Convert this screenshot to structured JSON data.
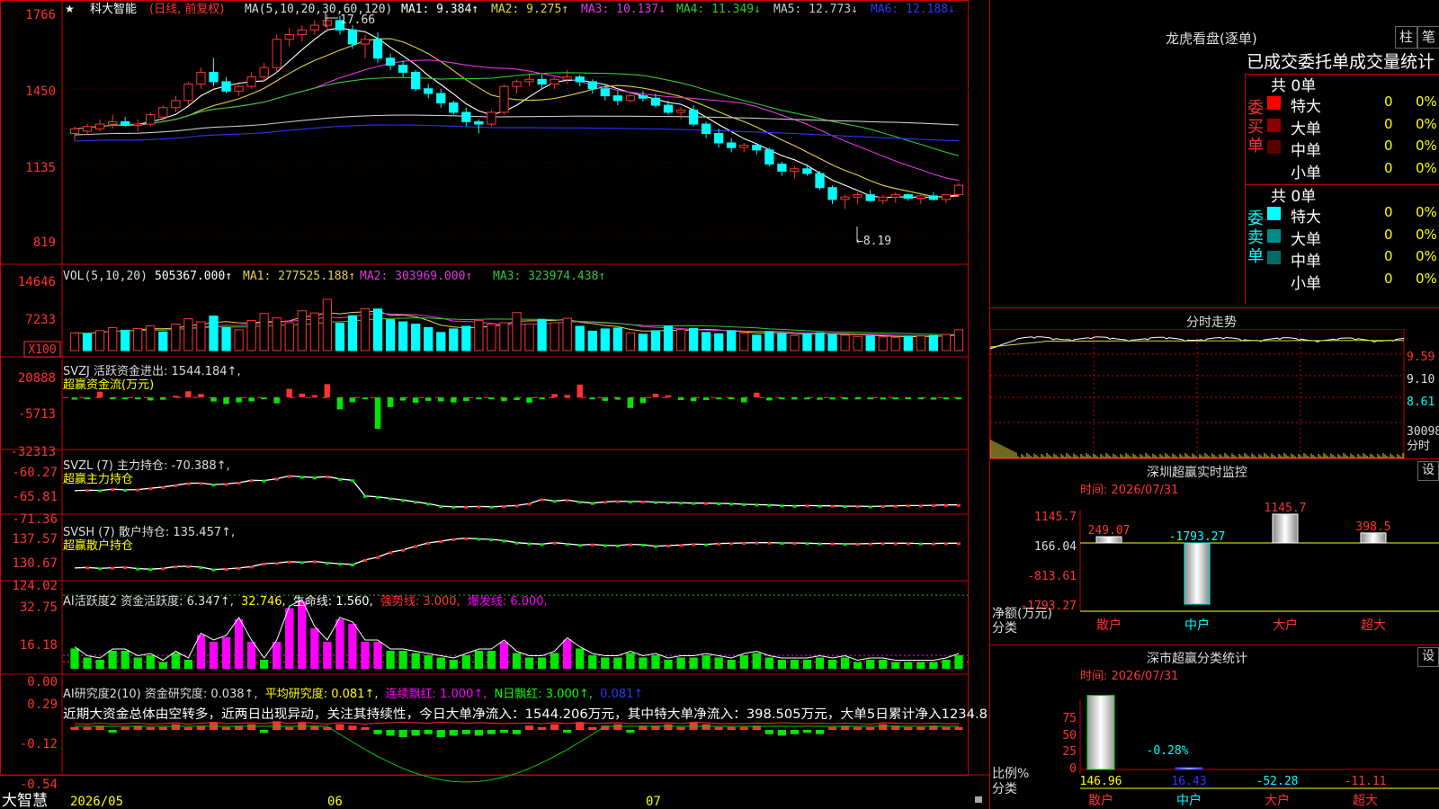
{
  "app": {
    "brand": "大智慧",
    "dates": [
      "2026/05",
      "06",
      "07"
    ]
  },
  "colors": {
    "up": "#ff3232",
    "down": "#00ffff",
    "ma1": "#ffffff",
    "ma2": "#e6d23c",
    "ma3": "#e632e6",
    "ma4": "#32c832",
    "ma5": "#c8c8c8",
    "ma6": "#3232ff",
    "pink": "#ff00ff",
    "green": "#00e600",
    "yellow": "#ffff00",
    "grid": "#c80000"
  },
  "kline": {
    "star": "★",
    "stock_name": "科大智能",
    "period": "(日线, 前复权)",
    "ma_params": "MA(5,10,20,30,60,120)",
    "ma": [
      {
        "label": "MA1: 9.384↑",
        "color": "#ffffff"
      },
      {
        "label": "MA2: 9.275↑",
        "color": "#e6d23c"
      },
      {
        "label": "MA3: 10.137↓",
        "color": "#e632e6"
      },
      {
        "label": "MA4: 11.349↓",
        "color": "#32c832"
      },
      {
        "label": "MA5: 12.773↓",
        "color": "#c8c8c8"
      },
      {
        "label": "MA6: 12.188↓",
        "color": "#3232ff"
      }
    ],
    "yticks": [
      "1766",
      "1450",
      "1135",
      "819"
    ],
    "high_label": "17.66",
    "low_label": "8.19"
  },
  "vol": {
    "header": "VOL(5,10,20)",
    "value": "505367.000↑",
    "ma": [
      {
        "label": "MA1: 277525.188↑",
        "color": "#e6d23c"
      },
      {
        "label": "MA2: 303969.000↑",
        "color": "#e632e6"
      },
      {
        "label": "MA3: 323974.438↑",
        "color": "#32c832"
      }
    ],
    "yticks": [
      "14646",
      "7233"
    ],
    "unit": "X100"
  },
  "svzj": {
    "line1": "SVZJ  活跃资金进出: 1544.184↑,",
    "line2": "超赢资金流(万元)",
    "yticks": [
      "20888",
      "-5713",
      "-32313"
    ]
  },
  "svzl": {
    "line1": "SVZL (7) 主力持仓: -70.388↑,",
    "line2": "超赢主力持仓",
    "yticks": [
      "-60.27",
      "-65.81",
      "-71.36"
    ]
  },
  "svsh": {
    "line1": "SVSH (7) 散户持仓: 135.457↑,",
    "line2": "超赢散户持仓",
    "yticks": [
      "137.57",
      "130.67",
      "124.02"
    ]
  },
  "ai2": {
    "prefix": "AI活跃度2 资金活跃度: 6.347↑,",
    "v2": "32.746,",
    "v3": "生命线: 1.560,",
    "v4": "强势线: 3.000,",
    "v5": "爆发线: 6.000,",
    "yticks": [
      "32.75",
      "16.18",
      "0.00"
    ]
  },
  "ai3": {
    "prefix": "AI研究度2(10) 资金研究度: 0.038↑,",
    "v2": "平均研究度: 0.081↑,",
    "v3": "连续飘红: 1.000↑,",
    "v4": "N日飘红: 3.000↑,",
    "v5": "0.081↑",
    "comment": "近期大资金总体由空转多，近两日出现异动，关注其持续性，今日大单净流入：1544.206万元，其中特大单净流入：398.505万元，大单5日累计净入1234.8",
    "yticks": [
      "0.29",
      "-0.12",
      "-0.54"
    ]
  },
  "panel": {
    "title": "龙虎看盘(逐单)",
    "btn1": "柱",
    "btn2": "笔",
    "subtitle": "已成交委托单成交量统计",
    "buy": {
      "side": "委买单",
      "total": "共 0单",
      "rows": [
        {
          "label": "特大",
          "val": "0",
          "pct": "0%",
          "color": "#ff0000"
        },
        {
          "label": "大单",
          "val": "0",
          "pct": "0%",
          "color": "#8b0000"
        },
        {
          "label": "中单",
          "val": "0",
          "pct": "0%",
          "color": "#5a0000"
        },
        {
          "label": "小单",
          "val": "0",
          "pct": "0%",
          "color": "#000000"
        }
      ]
    },
    "sell": {
      "side": "委卖单",
      "total": "共 0单",
      "rows": [
        {
          "label": "特大",
          "val": "0",
          "pct": "0%",
          "color": "#00ffff"
        },
        {
          "label": "大单",
          "val": "0",
          "pct": "0%",
          "color": "#008b8b"
        },
        {
          "label": "中单",
          "val": "0",
          "pct": "0%",
          "color": "#006a6a"
        },
        {
          "label": "小单",
          "val": "0",
          "pct": "0%",
          "color": "#000000"
        }
      ]
    }
  },
  "intraday": {
    "title": "分时走势",
    "ylabels": [
      "9.59",
      "9.10",
      "8.61"
    ],
    "vol_label": "30098",
    "unit": "分时"
  },
  "monitor": {
    "title": "深圳超赢实时监控",
    "time": "时间: 2026/07/31",
    "yticks": [
      "1145.7",
      "166.04",
      "-813.61",
      "-1793.27"
    ],
    "ylabel1": "净额(万元)",
    "ylabel2": "分类",
    "gear": "设"
  },
  "classify": {
    "title": "深市超赢分类统计",
    "time": "时间: 2026/07/31",
    "yticks": [
      "75",
      "50",
      "25",
      "0"
    ],
    "ylabel1": "比例%",
    "ylabel2": "分类",
    "pct_label": "-0.28%",
    "gear": "设"
  },
  "chart_data": [
    {
      "type": "candlestick",
      "title": "科大智能 (日线, 前复权)",
      "ylabel": "",
      "ylim": [
        819,
        1766
      ],
      "x_ticks": [
        "2026/05",
        "06",
        "07"
      ],
      "annotations": [
        {
          "text": "17.66",
          "at": "high"
        },
        {
          "text": "8.19",
          "at": "low"
        }
      ],
      "ohlc": [
        [
          1260,
          1290,
          1230,
          1280
        ],
        [
          1270,
          1300,
          1255,
          1290
        ],
        [
          1280,
          1320,
          1270,
          1300
        ],
        [
          1300,
          1340,
          1280,
          1310
        ],
        [
          1310,
          1330,
          1290,
          1295
        ],
        [
          1295,
          1320,
          1270,
          1300
        ],
        [
          1300,
          1350,
          1290,
          1340
        ],
        [
          1330,
          1380,
          1310,
          1370
        ],
        [
          1370,
          1420,
          1350,
          1400
        ],
        [
          1400,
          1480,
          1380,
          1470
        ],
        [
          1470,
          1540,
          1450,
          1520
        ],
        [
          1520,
          1580,
          1460,
          1480
        ],
        [
          1480,
          1500,
          1430,
          1440
        ],
        [
          1440,
          1470,
          1420,
          1460
        ],
        [
          1460,
          1520,
          1450,
          1500
        ],
        [
          1500,
          1560,
          1480,
          1540
        ],
        [
          1540,
          1680,
          1520,
          1660
        ],
        [
          1660,
          1710,
          1630,
          1680
        ],
        [
          1680,
          1720,
          1650,
          1700
        ],
        [
          1700,
          1740,
          1680,
          1720
        ],
        [
          1720,
          1766,
          1690,
          1740
        ],
        [
          1740,
          1760,
          1680,
          1700
        ],
        [
          1700,
          1720,
          1620,
          1640
        ],
        [
          1640,
          1680,
          1580,
          1660
        ],
        [
          1660,
          1690,
          1560,
          1580
        ],
        [
          1580,
          1600,
          1530,
          1550
        ],
        [
          1550,
          1570,
          1500,
          1520
        ],
        [
          1520,
          1530,
          1440,
          1450
        ],
        [
          1450,
          1470,
          1410,
          1430
        ],
        [
          1430,
          1450,
          1370,
          1390
        ],
        [
          1390,
          1400,
          1340,
          1350
        ],
        [
          1350,
          1370,
          1290,
          1310
        ],
        [
          1310,
          1320,
          1260,
          1300
        ],
        [
          1300,
          1360,
          1290,
          1350
        ],
        [
          1350,
          1470,
          1340,
          1460
        ],
        [
          1460,
          1490,
          1430,
          1480
        ],
        [
          1480,
          1510,
          1460,
          1490
        ],
        [
          1490,
          1510,
          1450,
          1470
        ],
        [
          1470,
          1500,
          1450,
          1490
        ],
        [
          1490,
          1530,
          1470,
          1500
        ],
        [
          1500,
          1510,
          1460,
          1480
        ],
        [
          1480,
          1490,
          1430,
          1450
        ],
        [
          1450,
          1470,
          1400,
          1420
        ],
        [
          1420,
          1440,
          1380,
          1400
        ],
        [
          1400,
          1430,
          1390,
          1420
        ],
        [
          1420,
          1440,
          1395,
          1410
        ],
        [
          1410,
          1430,
          1370,
          1380
        ],
        [
          1380,
          1400,
          1340,
          1350
        ],
        [
          1350,
          1370,
          1320,
          1360
        ],
        [
          1360,
          1380,
          1290,
          1300
        ],
        [
          1300,
          1310,
          1240,
          1260
        ],
        [
          1260,
          1280,
          1200,
          1220
        ],
        [
          1220,
          1240,
          1180,
          1200
        ],
        [
          1200,
          1220,
          1180,
          1210
        ],
        [
          1210,
          1220,
          1170,
          1190
        ],
        [
          1190,
          1200,
          1120,
          1130
        ],
        [
          1130,
          1140,
          1080,
          1100
        ],
        [
          1100,
          1120,
          1070,
          1110
        ],
        [
          1110,
          1130,
          1080,
          1090
        ],
        [
          1090,
          1100,
          1020,
          1030
        ],
        [
          1030,
          1040,
          960,
          980
        ],
        [
          980,
          1000,
          940,
          990
        ],
        [
          990,
          1010,
          960,
          1000
        ],
        [
          1000,
          1020,
          970,
          975
        ],
        [
          975,
          1000,
          960,
          990
        ],
        [
          990,
          1010,
          965,
          1000
        ],
        [
          1000,
          1005,
          975,
          985
        ],
        [
          985,
          1000,
          960,
          995
        ],
        [
          995,
          1010,
          975,
          980
        ],
        [
          980,
          1000,
          965,
          1000
        ],
        [
          1000,
          1050,
          990,
          1040
        ]
      ]
    },
    {
      "type": "bar",
      "title": "VOL(5,10,20)",
      "ylabel": "X100",
      "ylim": [
        0,
        14646
      ],
      "values": [
        4000,
        3800,
        4500,
        5200,
        4600,
        5000,
        5600,
        4200,
        6000,
        7200,
        6500,
        7800,
        5200,
        4700,
        6800,
        8400,
        7400,
        6300,
        9000,
        8500,
        11600,
        6200,
        7900,
        9500,
        9400,
        7000,
        6500,
        6000,
        5200,
        4100,
        4900,
        5500,
        6800,
        6000,
        6300,
        8600,
        6000,
        7000,
        6300,
        7300,
        5500,
        4400,
        4900,
        5100,
        4000,
        3700,
        4500,
        5600,
        4800,
        5000,
        4100,
        3800,
        4500,
        4000,
        3500,
        4200,
        3900,
        3400,
        3800,
        4000,
        3600,
        3500,
        3200,
        3300,
        3100,
        3000,
        3200,
        3300,
        3400,
        3600,
        4700
      ],
      "up": [
        1,
        0,
        1,
        1,
        0,
        1,
        1,
        0,
        1,
        1,
        1,
        0,
        0,
        1,
        1,
        1,
        1,
        1,
        1,
        1,
        1,
        0,
        0,
        1,
        0,
        0,
        0,
        0,
        0,
        0,
        0,
        0,
        1,
        1,
        1,
        1,
        1,
        0,
        1,
        1,
        0,
        0,
        0,
        0,
        1,
        0,
        0,
        0,
        1,
        0,
        0,
        0,
        0,
        1,
        0,
        0,
        0,
        1,
        0,
        0,
        0,
        1,
        1,
        0,
        1,
        1,
        0,
        1,
        0,
        1,
        1
      ]
    },
    {
      "type": "bar",
      "title": "超赢资金流(万元)",
      "ylabel": "",
      "ylim": [
        -32313,
        20888
      ],
      "values": [
        -1500,
        -800,
        4200,
        -900,
        -1200,
        -1000,
        -2100,
        -1600,
        1200,
        4500,
        2600,
        -2900,
        -4700,
        -3500,
        -2800,
        -1100,
        -4200,
        6200,
        2800,
        1700,
        9600,
        -8600,
        -3400,
        -1300,
        -22600,
        -6900,
        -2200,
        -3800,
        -2400,
        -2800,
        -3600,
        -2500,
        -1200,
        -1000,
        -2600,
        -1800,
        -3800,
        -1100,
        2500,
        1800,
        9300,
        -1100,
        -2400,
        -1500,
        -7500,
        -4100,
        2700,
        1600,
        -1800,
        -2700,
        -1800,
        -1300,
        -1000,
        -3500,
        3500,
        -2100,
        -1200,
        -1400,
        -1100,
        -1600,
        -1400,
        -900,
        -1000,
        -1000,
        -1400,
        -800,
        -1100,
        -700,
        -1500,
        -1000,
        -900
      ]
    },
    {
      "type": "line",
      "title": "超赢主力持仓",
      "ylabel": "",
      "ylim": [
        -71.36,
        -60.27
      ],
      "values": [
        -65.8,
        -65.6,
        -65.7,
        -65.3,
        -65.5,
        -65.4,
        -65.0,
        -64.6,
        -64.0,
        -63.4,
        -63.3,
        -63.8,
        -63.6,
        -63.2,
        -62.4,
        -62.5,
        -61.9,
        -61.0,
        -61.3,
        -61.5,
        -61.2,
        -62.0,
        -62.4,
        -67.5,
        -67.8,
        -68.3,
        -68.8,
        -69.4,
        -70.0,
        -70.8,
        -71.0,
        -71.0,
        -70.9,
        -71.0,
        -70.8,
        -70.6,
        -70.0,
        -68.6,
        -69.1,
        -68.8,
        -69.4,
        -69.8,
        -69.4,
        -69.2,
        -69.3,
        -69.3,
        -69.5,
        -69.6,
        -69.7,
        -69.8,
        -69.8,
        -69.9,
        -70.0,
        -70.2,
        -70.3,
        -70.4,
        -70.6,
        -70.7,
        -70.6,
        -70.7,
        -70.7,
        -70.8,
        -70.8,
        -70.9,
        -70.8,
        -70.7,
        -70.6,
        -70.6,
        -70.5,
        -70.4,
        -70.4
      ]
    },
    {
      "type": "line",
      "title": "超赢散户持仓",
      "ylabel": "",
      "ylim": [
        124.02,
        137.57
      ],
      "values": [
        126.5,
        126.7,
        126.4,
        126.6,
        126.8,
        126.3,
        126.1,
        126.4,
        127.0,
        127.1,
        126.8,
        126.0,
        126.2,
        126.5,
        127.0,
        128.0,
        128.2,
        128.7,
        128.5,
        128.8,
        128.3,
        128.0,
        127.7,
        129.3,
        130.2,
        131.9,
        132.7,
        134.0,
        135.1,
        135.7,
        136.4,
        136.7,
        136.5,
        136.3,
        135.9,
        135.2,
        134.9,
        134.7,
        135.2,
        134.8,
        134.4,
        134.6,
        134.3,
        134.2,
        134.6,
        134.5,
        134.0,
        134.2,
        134.4,
        134.7,
        134.6,
        134.9,
        135.0,
        135.1,
        135.2,
        135.2,
        135.1,
        135.1,
        135.0,
        134.9,
        134.9,
        134.8,
        134.8,
        134.9,
        135.0,
        135.0,
        135.0,
        134.9,
        134.9,
        135.0,
        135.0
      ]
    },
    {
      "type": "bar",
      "title": "AI活跃度2",
      "ylabel": "",
      "ylim": [
        0,
        32.75
      ],
      "values": [
        9,
        5,
        4,
        8,
        8,
        5,
        6,
        3,
        7,
        4,
        15,
        12,
        14,
        22,
        12,
        4,
        12,
        27,
        30,
        18,
        12,
        22,
        20,
        12,
        12,
        8,
        8,
        7,
        6,
        5,
        4,
        6,
        8,
        8,
        12,
        7,
        5,
        5,
        7,
        13,
        9,
        6,
        5,
        5,
        7,
        5,
        6,
        4,
        5,
        5,
        6,
        5,
        4,
        6,
        7,
        5,
        4,
        4,
        4,
        5,
        4,
        5,
        3,
        4,
        4,
        3,
        3,
        3,
        3,
        4,
        6
      ],
      "series": [
        {
          "name": "生命线",
          "value": 1.56
        },
        {
          "name": "强势线",
          "value": 3.0
        },
        {
          "name": "爆发线",
          "value": 6.0
        }
      ]
    },
    {
      "type": "bar",
      "title": "AI研究度2(10)",
      "ylabel": "",
      "ylim": [
        -0.54,
        0.29
      ],
      "values": [
        0.02,
        0.01,
        0.03,
        -0.01,
        0.02,
        0.03,
        0.01,
        0.02,
        0.04,
        0.01,
        0.03,
        0.05,
        0.02,
        0.03,
        0.04,
        -0.02,
        0.06,
        0.02,
        0.05,
        0.03,
        0.01,
        0.04,
        0.03,
        0.01,
        -0.03,
        -0.04,
        -0.05,
        -0.04,
        -0.03,
        -0.05,
        -0.04,
        -0.03,
        -0.04,
        -0.03,
        -0.02,
        -0.03,
        0.03,
        0.02,
        0.04,
        -0.02,
        0.05,
        0.02,
        0.03,
        0.04,
        -0.02,
        0.03,
        0.03,
        0.04,
        0.02,
        0.05,
        0.04,
        0.02,
        0.02,
        0.02,
        0.03,
        -0.03,
        -0.04,
        -0.03,
        -0.02,
        -0.03,
        0.02,
        0.03,
        0.02,
        0.01,
        0.04,
        0.03,
        0.02,
        0.02,
        0.03,
        0.02,
        0.02
      ]
    },
    {
      "type": "bar",
      "title": "深圳超赢实时监控",
      "ylabel": "净额(万元)",
      "ylim": [
        -1793.27,
        1145.7
      ],
      "categories": [
        "散户",
        "中户",
        "大户",
        "超大"
      ],
      "values": [
        249.07,
        -1793.27,
        1145.7,
        398.5
      ]
    },
    {
      "type": "bar",
      "title": "深市超赢分类统计",
      "ylabel": "比例%",
      "ylim": [
        0,
        75
      ],
      "categories": [
        "散户",
        "中户",
        "大户",
        "超大"
      ],
      "values": [
        146.96,
        16.43,
        -52.28,
        -11.11
      ],
      "annotations": [
        {
          "text": "-0.28%",
          "category": "中户"
        }
      ]
    }
  ]
}
